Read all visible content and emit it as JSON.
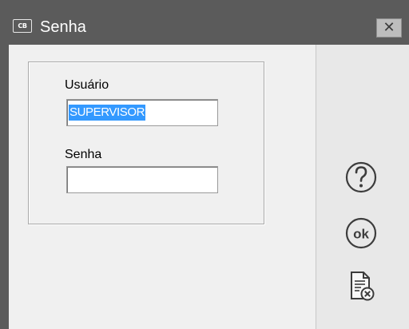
{
  "window": {
    "title": "Senha",
    "app_icon_text": "CB"
  },
  "form": {
    "user_label": "Usuário",
    "user_value": "SUPERVISOR",
    "password_label": "Senha",
    "password_value": ""
  },
  "actions": [
    {
      "name": "help",
      "icon": "question-circle-icon"
    },
    {
      "name": "ok",
      "icon": "ok-circle-icon",
      "label": "ok"
    },
    {
      "name": "cancel",
      "icon": "document-cancel-icon"
    }
  ],
  "colors": {
    "titlebar": "#5b5b5b",
    "client_bg": "#f0f0f0",
    "selection": "#3399ff"
  }
}
